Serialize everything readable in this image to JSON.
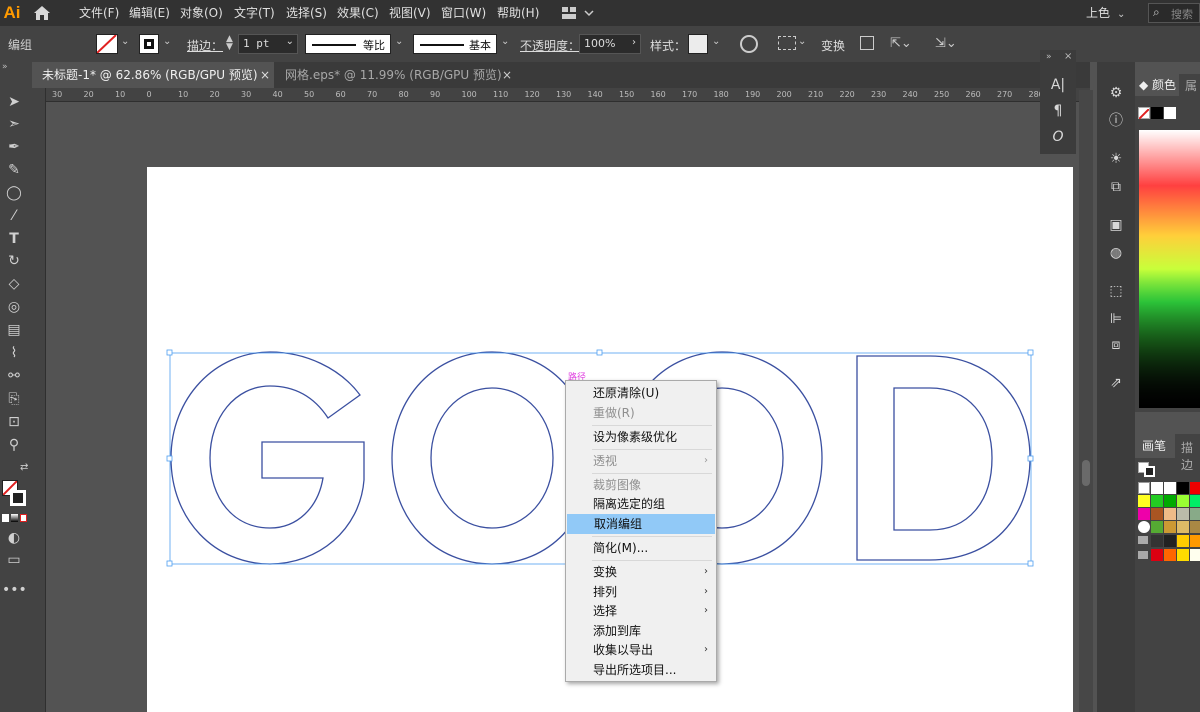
{
  "app": {
    "logo": "Ai"
  },
  "menu": [
    {
      "label": "文件(F)"
    },
    {
      "label": "编辑(E)"
    },
    {
      "label": "对象(O)"
    },
    {
      "label": "文字(T)"
    },
    {
      "label": "选择(S)"
    },
    {
      "label": "效果(C)"
    },
    {
      "label": "视图(V)"
    },
    {
      "label": "窗口(W)"
    },
    {
      "label": "帮助(H)"
    }
  ],
  "workspace": {
    "label": "上色",
    "search_placeholder": "搜索"
  },
  "control": {
    "selection_label": "编组",
    "stroke_label": "描边：",
    "stroke_weight": "1 pt",
    "profile_label": "等比",
    "brush_label": "基本",
    "opacity_label": "不透明度：",
    "opacity_value": "100%",
    "style_label": "样式：",
    "transform_label": "变换"
  },
  "tabs": [
    {
      "label": "未标题-1* @ 62.86% (RGB/GPU 预览)",
      "close": "×",
      "active": true
    },
    {
      "label": "网格.eps* @ 11.99% (RGB/GPU 预览)",
      "close": "×",
      "active": false
    }
  ],
  "ruler": {
    "labels": [
      "30",
      "20",
      "10",
      "0",
      "10",
      "20",
      "30",
      "40",
      "50",
      "60",
      "70",
      "80",
      "90",
      "100",
      "110",
      "120",
      "130",
      "140",
      "150",
      "160",
      "170",
      "180",
      "190",
      "200",
      "210",
      "220",
      "230",
      "240",
      "250",
      "260",
      "270",
      "280"
    ]
  },
  "artwork": {
    "text": "GOOD",
    "path_hint": "路径",
    "stroke_color": "#3a4fa0"
  },
  "context_menu": {
    "items": [
      {
        "label": "还原清除(U)",
        "enabled": true
      },
      {
        "label": "重做(R)",
        "enabled": false
      },
      {
        "label": "设为像素级优化",
        "enabled": true
      },
      {
        "label": "透视",
        "enabled": false,
        "submenu": true
      },
      {
        "label": "裁剪图像",
        "enabled": false
      },
      {
        "label": "隔离选定的组",
        "enabled": true
      },
      {
        "label": "取消编组",
        "enabled": true,
        "highlighted": true
      },
      {
        "label": "简化(M)...",
        "enabled": true
      },
      {
        "label": "变换",
        "enabled": true,
        "submenu": true
      },
      {
        "label": "排列",
        "enabled": true,
        "submenu": true
      },
      {
        "label": "选择",
        "enabled": true,
        "submenu": true
      },
      {
        "label": "添加到库",
        "enabled": true
      },
      {
        "label": "收集以导出",
        "enabled": true,
        "submenu": true
      },
      {
        "label": "导出所选项目...",
        "enabled": true
      }
    ]
  },
  "panels": {
    "color_tab": "颜色",
    "color_tab2": "属",
    "brush_tab": "画笔",
    "brush_tab2": "描边"
  },
  "colors": {
    "ui_dark": "#323232",
    "ui_mid": "#434343",
    "ui_canvas": "#535353",
    "highlight": "#91c9f7",
    "accent_logo": "#ff9a00"
  }
}
